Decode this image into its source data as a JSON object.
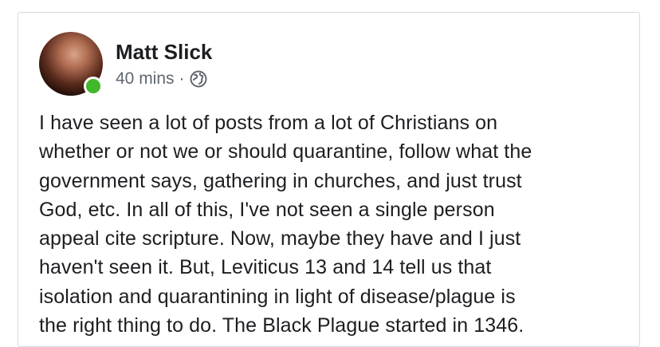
{
  "post": {
    "author": "Matt Slick",
    "time": "40 mins",
    "separator": "·",
    "privacy_icon": "globe-icon",
    "online_color": "#42b72a",
    "text": "I have seen a lot of posts from a lot of Christians on\nwhether or not we or should quarantine, follow what the\ngovernment says, gathering in churches, and just trust\nGod, etc. In all of this, I've not seen a single person\nappeal cite scripture. Now, maybe they have and I just\nhaven't seen it. But, Leviticus 13 and 14 tell us that\nisolation and quarantining in light of disease/plague is\nthe right thing to do.  The Black Plague started in 1346."
  }
}
